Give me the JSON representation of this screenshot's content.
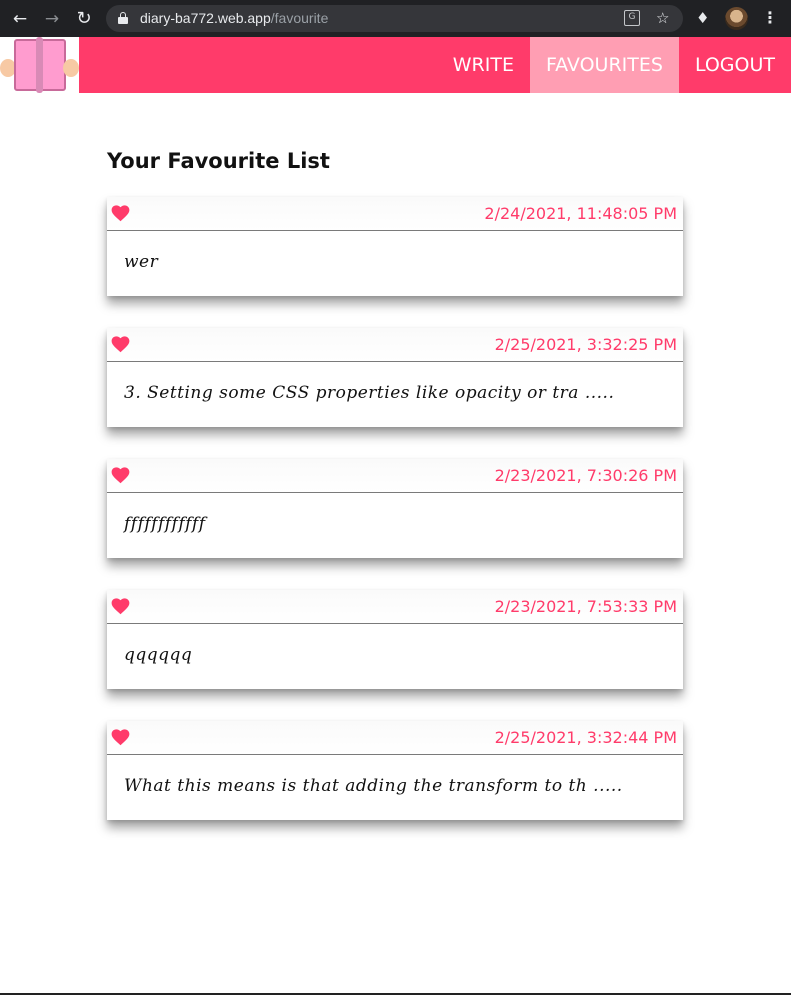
{
  "browser": {
    "url_host": "diary-ba772.web.app",
    "url_path": "/favourite"
  },
  "navbar": {
    "links": [
      {
        "label": "WRITE",
        "active": false
      },
      {
        "label": "FAVOURITES",
        "active": true
      },
      {
        "label": "LOGOUT",
        "active": false
      }
    ]
  },
  "page": {
    "title": "Your Favourite List"
  },
  "favourites": [
    {
      "date": "2/24/2021, 11:48:05 PM",
      "text": "wer"
    },
    {
      "date": "2/25/2021, 3:32:25 PM",
      "text": "3. Setting some CSS properties like opacity or tra ....."
    },
    {
      "date": "2/23/2021, 7:30:26 PM",
      "text": "ffffffffffff"
    },
    {
      "date": "2/23/2021, 7:53:33 PM",
      "text": "qqqqqq"
    },
    {
      "date": "2/25/2021, 3:32:44 PM",
      "text": "What this means is that adding the transform to th ....."
    }
  ],
  "colors": {
    "brand": "#ff3b6a",
    "nav_active": "#ff9eb3"
  }
}
